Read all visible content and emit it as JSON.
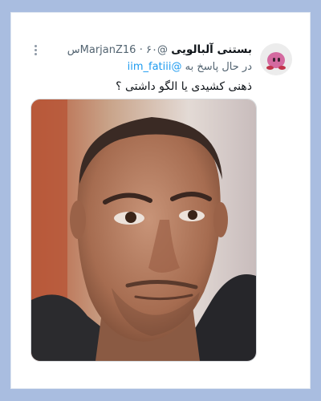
{
  "tweet": {
    "display_name": "بستنی آلبالویی",
    "handle": "@MarjanZ16",
    "time": "۶۰س",
    "reply_prefix": "در حال پاسخ به",
    "reply_to": "@iim_fatiii",
    "text": "ذهنی کشیدی یا الگو داشتی ؟"
  },
  "icons": {
    "avatar": "kirby-avatar",
    "more": "more-vertical-icon"
  },
  "colors": {
    "background": "#a9bde0",
    "mention": "#1d9bf0",
    "text": "#0f1419",
    "secondary": "#536471"
  }
}
